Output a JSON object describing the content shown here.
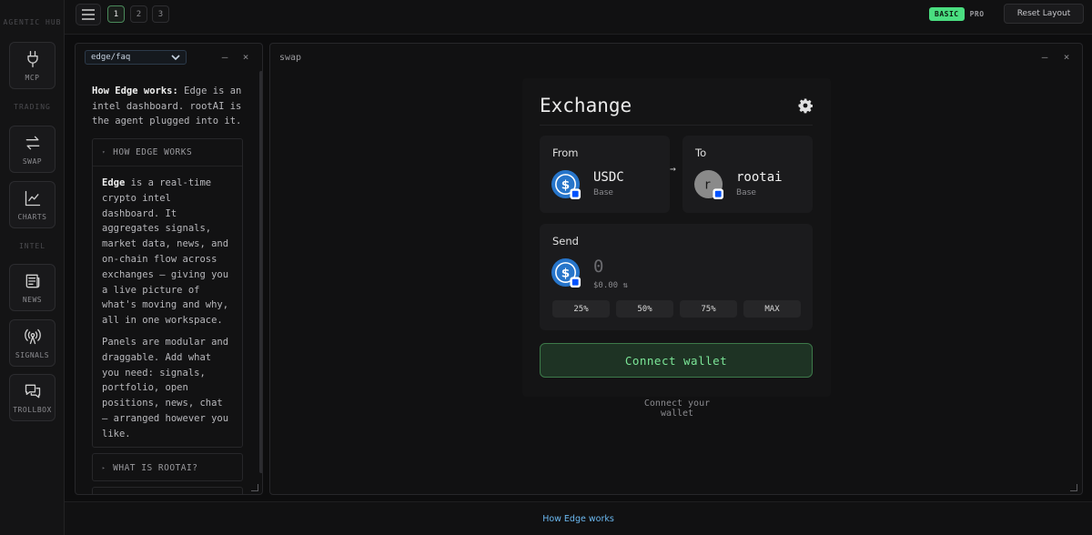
{
  "rail": {
    "brand": "AGENTIC HUB",
    "sections": {
      "trading": "TRADING",
      "intel": "INTEL"
    },
    "items": [
      {
        "label": "MCP",
        "icon": "plug-icon"
      },
      {
        "label": "SWAP",
        "icon": "swap-arrows-icon"
      },
      {
        "label": "CHARTS",
        "icon": "line-chart-icon"
      },
      {
        "label": "NEWS",
        "icon": "newspaper-icon"
      },
      {
        "label": "SIGNALS",
        "icon": "broadcast-icon"
      },
      {
        "label": "TROLLBOX",
        "icon": "chat-bubbles-icon"
      }
    ]
  },
  "topbar": {
    "workspaces": [
      "1",
      "2",
      "3"
    ],
    "active_workspace": "1",
    "mode": {
      "basic": "BASIC",
      "pro": "PRO",
      "active": "BASIC"
    },
    "reset_label": "Reset Layout",
    "accent": "#4ade80"
  },
  "faq_panel": {
    "select_value": "edge/faq",
    "intro_title": "How Edge works:",
    "intro_text": "Edge is an intel dashboard. rootAI is the agent plugged into it.",
    "sections": [
      {
        "title": "HOW EDGE WORKS",
        "lead": "Edge",
        "p1": "is a real-time crypto intel dashboard. It aggregates signals, market data, news, and on-chain flow across exchanges — giving you a live picture of what's moving and why, all in one workspace.",
        "p2": "Panels are modular and draggable. Add what you need: signals, portfolio, open positions, news, chat — arranged however you like."
      },
      {
        "title": "WHAT IS ROOTAI?"
      }
    ]
  },
  "swap_panel": {
    "title": "swap",
    "exchange": {
      "title": "Exchange",
      "from": {
        "label": "From",
        "symbol": "USDC",
        "chain": "Base"
      },
      "to": {
        "label": "To",
        "symbol": "rootai",
        "chain": "Base",
        "avatar_letter": "r"
      },
      "send": {
        "label": "Send",
        "amount": "0",
        "usd": "$0.00 ⇅"
      },
      "percents": [
        "25%",
        "50%",
        "75%",
        "MAX"
      ],
      "connect_label": "Connect wallet",
      "hint": "Connect your wallet"
    }
  },
  "footer": {
    "link": "How Edge works"
  },
  "colors": {
    "usdc": "#2775ca",
    "connect_text": "#7be597",
    "link": "#6bb8f0"
  }
}
